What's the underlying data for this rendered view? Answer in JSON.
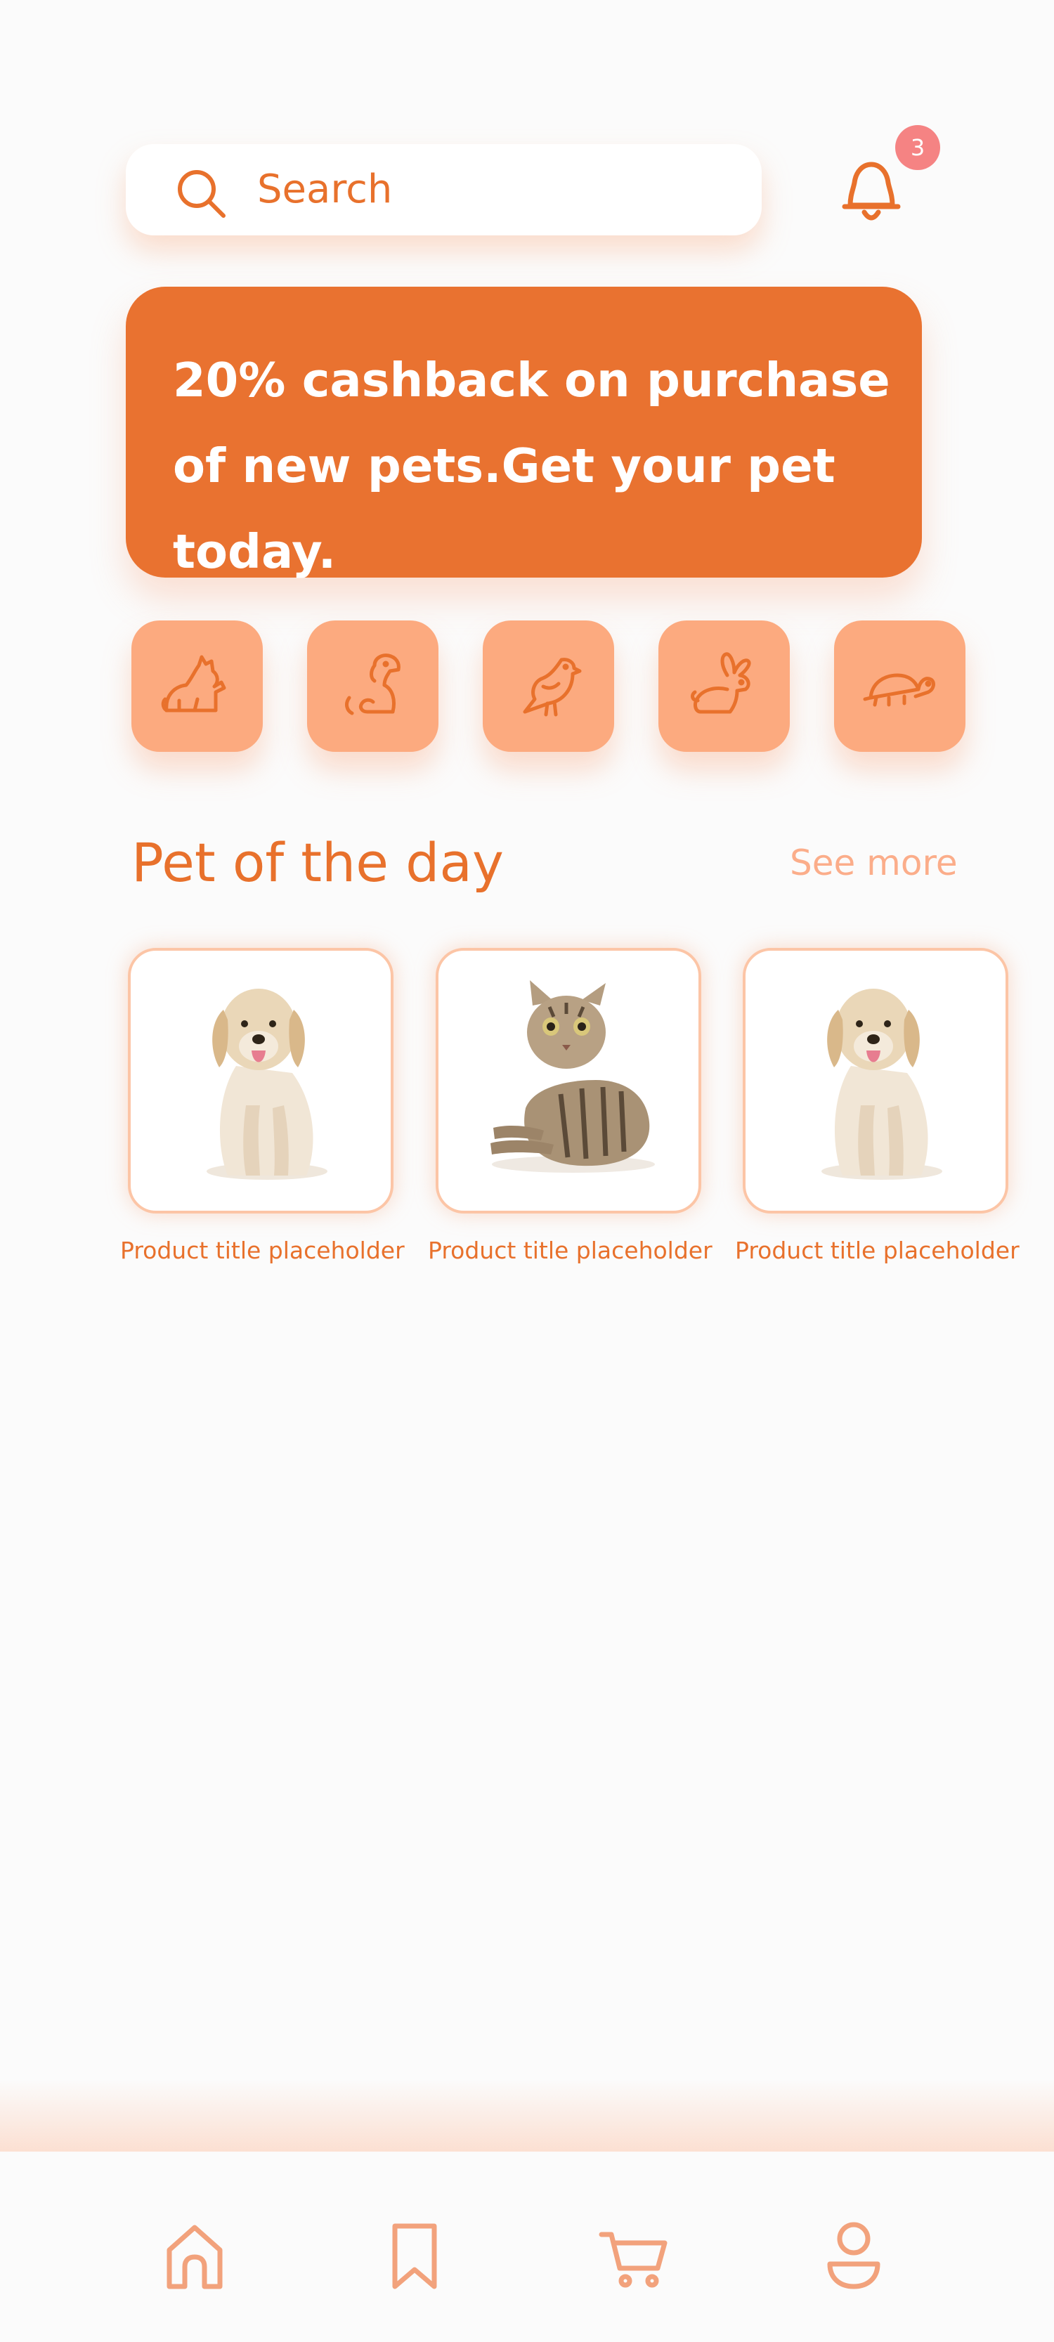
{
  "search": {
    "placeholder": "Search",
    "icon": "search-icon"
  },
  "notifications": {
    "icon": "bell-icon",
    "count": "3",
    "badge_color": "#f58383"
  },
  "banner": {
    "text": "20% cashback on purchase of new pets.Get your pet today.",
    "background": "#e97230"
  },
  "categories": [
    {
      "icon": "cat-icon"
    },
    {
      "icon": "dog-icon"
    },
    {
      "icon": "bird-icon"
    },
    {
      "icon": "rabbit-icon"
    },
    {
      "icon": "turtle-icon"
    }
  ],
  "pet_of_the_day": {
    "title": "Pet of the day",
    "see_more": "See more",
    "products": [
      {
        "image": "dog-photo",
        "title": "Product title placeholder"
      },
      {
        "image": "cat-photo",
        "title": "Product title placeholder"
      },
      {
        "image": "dog-photo",
        "title": "Product title placeholder"
      }
    ]
  },
  "bottom_nav": [
    {
      "icon": "home-icon"
    },
    {
      "icon": "bookmark-icon"
    },
    {
      "icon": "cart-icon"
    },
    {
      "icon": "profile-icon"
    }
  ],
  "colors": {
    "accent": "#e8712c",
    "light_accent": "#fcaa7f",
    "background": "#fbfbfb"
  }
}
